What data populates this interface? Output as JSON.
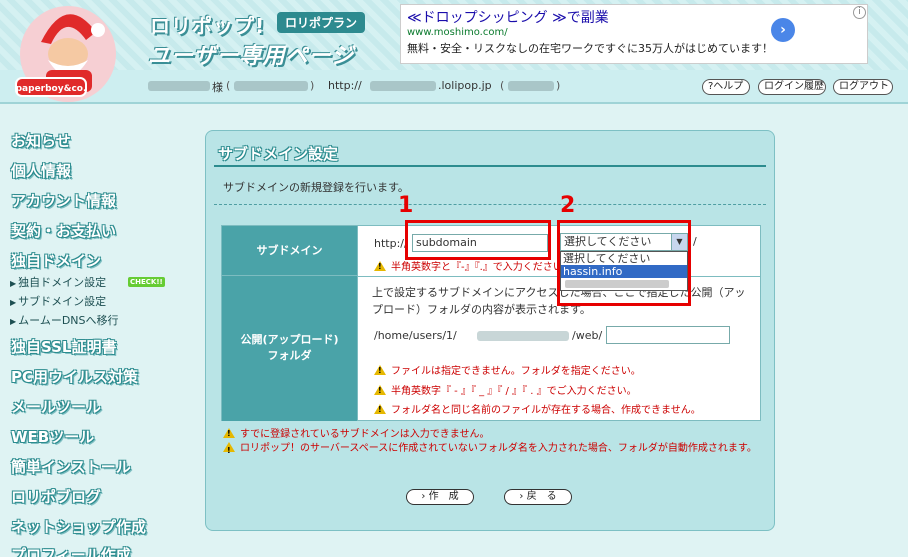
{
  "header": {
    "logo_line1": "ロリポップ!",
    "plan_badge": "ロリポプラン",
    "logo_line2": "ユーザー専用ページ",
    "mascot_label": "paperboy&co.",
    "user_honorific": "様",
    "paren_open": "(",
    "paren_close": ")",
    "url_prefix": "http://",
    "url_suffix": ".lolipop.jp",
    "help_label": "?ヘルプ",
    "history_label": "ログイン履歴",
    "logout_label": "ログアウト"
  },
  "ad": {
    "title": "≪ドロップシッピング ≫で副業",
    "url": "www.moshimo.com/",
    "desc": "無料・安全・リスクなしの在宅ワークですぐに35万人がはじめています！",
    "arrow": "›",
    "info": "i"
  },
  "sidebar": {
    "items": [
      "お知らせ",
      "個人情報",
      "アカウント情報",
      "契約・お支払い",
      "独自ドメイン"
    ],
    "sub_items": [
      "独自ドメイン設定",
      "サブドメイン設定",
      "ムームーDNSへ移行"
    ],
    "check_badge": "CHECK!!",
    "items2": [
      "独自SSL証明書",
      "PC用ウイルス対策",
      "メールツール",
      "WEBツール",
      "簡単インストール",
      "ロリポブログ",
      "ネットショップ作成",
      "プロフィール作成"
    ]
  },
  "panel": {
    "title": "サブドメイン設定",
    "desc": "サブドメインの新規登録を行います。",
    "row1_label": "サブドメイン",
    "http_prefix": "http://",
    "subdomain_value": "subdomain",
    "select_value": "選択してください",
    "slash": "/",
    "dropdown_options": [
      "選択してください",
      "hassin.info"
    ],
    "warn_half": "半角英数字と『-』『.』で入力ください。",
    "row2_label_line1": "公開(アップロード)",
    "row2_label_line2": "フォルダ",
    "pub_desc": "上で設定するサブドメインにアクセスした場合、ここで指定した公開（アップロード）フォルダの内容が表示されます。",
    "path_prefix": "/home/users/1/",
    "path_suffix": "/web/",
    "pub_warn1": "ファイルは指定できません。フォルダを指定ください。",
    "pub_warn2": "半角英数字『 - 』『 _ 』『 / 』『 . 』でご入力ください。",
    "pub_warn3": "フォルダ名と同じ名前のファイルが存在する場合、作成できません。",
    "warn_bottom1": "すでに登録されているサブドメインは入力できません。",
    "warn_bottom2": "ロリポップ！のサーバースペースに作成されていないフォルダ名を入力された場合、フォルダが自動作成されます。",
    "create_label": "› 作　成",
    "back_label": "› 戻　る"
  },
  "annotations": {
    "num1": "1",
    "num2": "2",
    "color": "#e60000"
  }
}
